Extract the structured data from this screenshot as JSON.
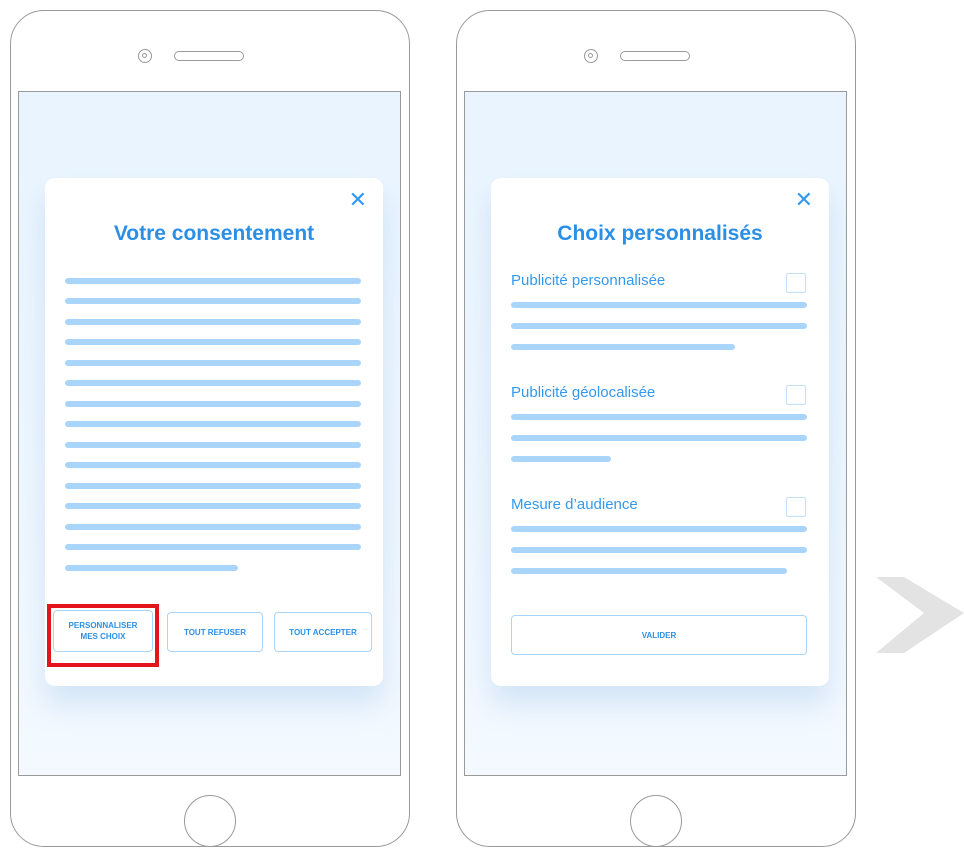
{
  "consent_screen": {
    "title": "Votre consentement",
    "close_symbol": "✕",
    "buttons": {
      "customize_line1": "PERSONNALISER",
      "customize_line2": "MES CHOIX",
      "refuse_all": "TOUT REFUSER",
      "accept_all": "TOUT ACCEPTER"
    }
  },
  "custom_choices_screen": {
    "title": "Choix personnalisés",
    "close_symbol": "✕",
    "options": [
      {
        "label": "Publicité personnalisée",
        "checked": false
      },
      {
        "label": "Publicité géolocalisée",
        "checked": false
      },
      {
        "label": "Mesure d’audience",
        "checked": false
      }
    ],
    "validate_label": "VALIDER"
  },
  "icons": {
    "close": "close-icon",
    "checkbox": "checkbox-icon",
    "flow_arrow": "arrow-icon"
  },
  "colors": {
    "accent": "#2b8fe6",
    "placeholder_line": "#a9d5fb",
    "highlight": "#e3141b",
    "screen_background": "#e9f4fe",
    "device_outline": "#9a9a9a"
  }
}
